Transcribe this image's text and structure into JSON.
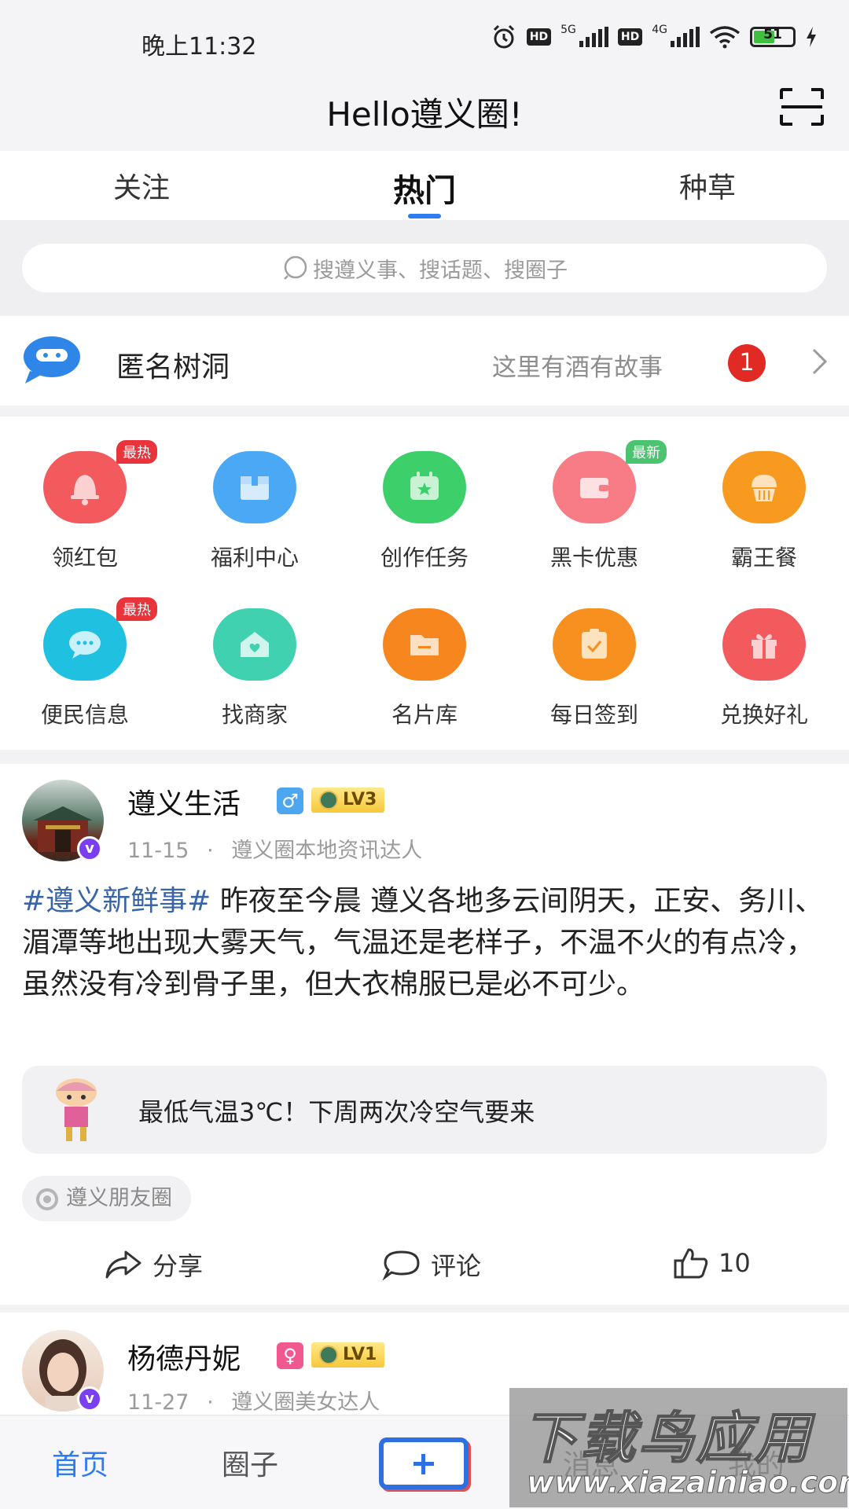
{
  "status_bar": {
    "time": "晚上11:32",
    "hd1": "HD",
    "net1": "5G",
    "hd2": "HD",
    "net2": "4G",
    "battery": "51"
  },
  "header": {
    "title": "Hello遵义圈!"
  },
  "tabs": [
    {
      "label": "关注"
    },
    {
      "label": "热门",
      "active": true
    },
    {
      "label": "种草"
    }
  ],
  "search": {
    "placeholder": "搜遵义事、搜话题、搜圈子"
  },
  "tree_hole": {
    "title": "匿名树洞",
    "subtitle": "这里有酒有故事",
    "badge": "1"
  },
  "functions": [
    {
      "label": "领红包",
      "tag": "最热",
      "icon": "bell-icon",
      "color": "#f25a5e"
    },
    {
      "label": "福利中心",
      "tag": "",
      "icon": "box-icon",
      "color": "#4aa8f5"
    },
    {
      "label": "创作任务",
      "tag": "",
      "icon": "calendar-icon",
      "color": "#3ccf6a"
    },
    {
      "label": "黑卡优惠",
      "tag": "最新",
      "icon": "wallet-icon",
      "color": "#f77c86"
    },
    {
      "label": "霸王餐",
      "tag": "",
      "icon": "cupcake-icon",
      "color": "#f79a1f"
    },
    {
      "label": "便民信息",
      "tag": "最热",
      "icon": "chat-icon",
      "color": "#20c0e0"
    },
    {
      "label": "找商家",
      "tag": "",
      "icon": "house-icon",
      "color": "#3fd1b0"
    },
    {
      "label": "名片库",
      "tag": "",
      "icon": "folder-icon",
      "color": "#f7861f"
    },
    {
      "label": "每日签到",
      "tag": "",
      "icon": "clipboard-check-icon",
      "color": "#f7901f"
    },
    {
      "label": "兑换好礼",
      "tag": "",
      "icon": "gift-icon",
      "color": "#f25a5e"
    }
  ],
  "post": {
    "author": "遵义生活",
    "gender": "♂",
    "level": "LV3",
    "date": "11-15",
    "role": "遵义圈本地资讯达人",
    "hashtag": "#遵义新鲜事#",
    "text": " 昨夜至今晨 遵义各地多云间阴天，正安、务川、湄潭等地出现大雾天气，气温还是老样子，不温不火的有点冷，虽然没有冷到骨子里，但大衣棉服已是必不可少。",
    "quote": "最低气温3℃！下周两次冷空气要来",
    "circle": "遵义朋友圈",
    "share": "分享",
    "comment": "评论",
    "likes": "10"
  },
  "post2": {
    "author": "杨德丹妮",
    "gender": "♀",
    "level": "LV1",
    "date": "11-27",
    "role": "遵义圈美女达人"
  },
  "nav": {
    "home": "首页",
    "circle": "圈子",
    "msg": "消息",
    "me": "我的"
  },
  "watermark": {
    "text": "下载鸟应用",
    "url": "www.xiazainiao.com"
  },
  "colors": {
    "accent": "#2f7bf0",
    "hashtag": "#3a64a8",
    "badge": "#e02a23"
  }
}
